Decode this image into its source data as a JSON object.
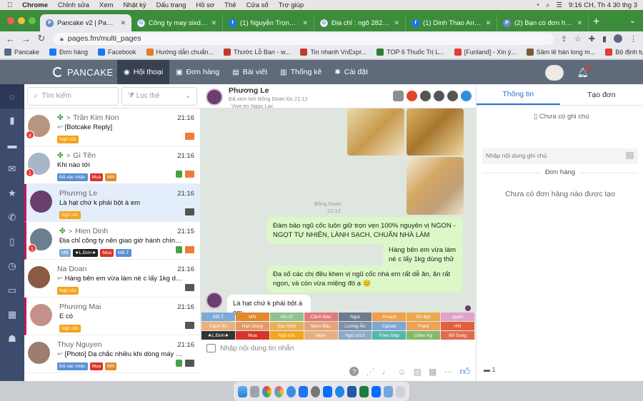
{
  "macbar": {
    "apple": "",
    "app": "Chrome",
    "menus": [
      "Chỉnh sửa",
      "Xem",
      "Nhật ký",
      "Dấu trang",
      "Hồ sơ",
      "Thẻ",
      "Cửa sổ",
      "Trợ giúp"
    ],
    "datetime": "9:16 CH, Th 4 30 thg 3"
  },
  "tabs": [
    {
      "title": "Pancake v2 | Pages.fm |",
      "icon": "P",
      "active": true
    },
    {
      "title": "Công ty may sixdo hoàn",
      "icon": "G"
    },
    {
      "title": "(1) Nguyễn Trọng Vinh |",
      "icon": "f"
    },
    {
      "title": "Địa chỉ : ngõ 282 Nguyễ",
      "icon": "G"
    },
    {
      "title": "(1) Dinh Thao Anh | Face",
      "icon": "f"
    },
    {
      "title": "(2) Bạn có đơn hàng mới",
      "icon": "P"
    }
  ],
  "address": {
    "url": "pages.fm/multi_pages"
  },
  "bookmarks": [
    "Pancake",
    "Đơn hàng",
    "Facebook",
    "Hướng dẫn chuẩn...",
    "Thước Lỗ Ban - w...",
    "Tin nhanh VnExpr...",
    "TOP 6 Thuốc Trị L...",
    "[Funland] - Xin ý...",
    "Sâm lê hàn long m...",
    "Bộ định tuyến WiF..."
  ],
  "app": {
    "logo": "PANCAKE",
    "nav": [
      {
        "label": "Hội thoại",
        "active": true
      },
      {
        "label": "Đơn hàng"
      },
      {
        "label": "Bài viết"
      },
      {
        "label": "Thống kê"
      },
      {
        "label": "Cài đặt"
      }
    ]
  },
  "filters": {
    "search_placeholder": "Tìm kiếm",
    "filter_label": "Lọc thẻ"
  },
  "conversations": [
    {
      "name": "Trần Kim Non",
      "leaf": true,
      "time": "21:16",
      "msg": "[Botcake Reply]",
      "reply": true,
      "badge": "4",
      "tags": [
        {
          "t": "Ngũ cốc",
          "c": "#f5a31a"
        }
      ],
      "icons": [
        "mail-orange"
      ],
      "avatar": "#b89580"
    },
    {
      "name": "Gì Tên",
      "leaf": true,
      "time": "21:16",
      "msg": "Khi nào tới",
      "reply": false,
      "badge": "1",
      "tags": [
        {
          "t": "Đã xác nhận",
          "c": "#5b8fd6"
        },
        {
          "t": "Mua",
          "c": "#d8342b"
        },
        {
          "t": "MN",
          "c": "#e08a2b"
        }
      ],
      "icons": [
        "phone",
        "mail-orange"
      ],
      "avatar": "#a7b7c8"
    },
    {
      "name": "Phương Le",
      "leaf": false,
      "time": "21:16",
      "msg": "Là hạt chứ k phải bột à em",
      "reply": false,
      "badge": "",
      "tags": [
        {
          "t": "Ngũ cốc",
          "c": "#f5a31a"
        }
      ],
      "icons": [
        "mail-dark"
      ],
      "avatar": "#6b3e6e",
      "selected": true
    },
    {
      "name": "Hien Dinh",
      "leaf": true,
      "time": "21:15",
      "msg": "Địa chỉ công ty nên giao giờ hành chính giúp c",
      "reply": false,
      "badge": "1",
      "tags": [
        {
          "t": "MB",
          "c": "#7ea8d8"
        },
        {
          "t": "★L.Đơn★",
          "c": "#222"
        },
        {
          "t": "Mua",
          "c": "#d8342b"
        },
        {
          "t": "MB.T",
          "c": "#5b8fd6"
        }
      ],
      "icons": [
        "phone",
        "mail-orange"
      ],
      "avatar": "#6b7f8e",
      "pink": true
    },
    {
      "name": "Na Doan",
      "leaf": false,
      "time": "21:16",
      "msg": "Hàng bên em vừa làm nè c lấy 1kg dùng thử nha ^^",
      "reply": true,
      "badge": "",
      "tags": [
        {
          "t": "Ngũ cốc",
          "c": "#f5a31a"
        }
      ],
      "icons": [
        "mail-dark"
      ],
      "avatar": "#8a5a44"
    },
    {
      "name": "Phương Mai",
      "leaf": false,
      "time": "21:16",
      "msg": "E có",
      "reply": false,
      "badge": "",
      "tags": [
        {
          "t": "Ngũ cốc",
          "c": "#f5a31a"
        }
      ],
      "icons": [
        "mail-dark"
      ],
      "avatar": "#c4918a",
      "pink": true
    },
    {
      "name": "Thuy Nguyen",
      "leaf": false,
      "time": "21:16",
      "msg": "[Photo] Dạ chắc nhiều khi dòng máy chị dùng ko t...",
      "reply": true,
      "badge": "",
      "tags": [
        {
          "t": "Đã xác nhận",
          "c": "#5b8fd6"
        },
        {
          "t": "Mua",
          "c": "#d8342b"
        },
        {
          "t": "MN",
          "c": "#e08a2b"
        }
      ],
      "icons": [
        "phone",
        "mail-dark"
      ],
      "avatar": "#9c7d70"
    }
  ],
  "chat": {
    "name": "Phương Le",
    "seen": "Đã xem bởi Bông Doan lúc 21:12",
    "sub": "Vive en Ngọc Lạc",
    "photo_sender": "Bông Doan",
    "photo_time": "21:13",
    "messages": [
      {
        "text": "Đảm bảo ngũ cốc luôn giữ trọn vẹn 100% nguyên vị NGON - NGỌT TỰ NHIÊN, LÀNH SẠCH, CHUẨN NHÀ LÀM"
      },
      {
        "text": "Hàng bên em vừa làm nè c lấy 1kg dùng thử nha ^^"
      },
      {
        "text": "Đa số các chị đều khen vị ngũ cốc nhà em rất dễ ăn, ăn rất ngon, và còn vừa miệng đó ạ 😊"
      }
    ],
    "incoming": "Là hạt chứ k phải bột à em",
    "input_placeholder": "Nhập nội dung tin nhắn"
  },
  "quick_tags": [
    {
      "t": "MB.T",
      "c": "#7ea8d8"
    },
    {
      "t": "MN",
      "c": "#e08a2b"
    },
    {
      "t": "Hỏi Sĩ",
      "c": "#8fc28f"
    },
    {
      "t": "Cảnh Báo",
      "c": "#e07b7b"
    },
    {
      "t": "Ngọt",
      "c": "#6d7c8c"
    },
    {
      "t": "Ymach",
      "c": "#f0a04b"
    },
    {
      "t": "Bỏ Bột",
      "c": "#e9a94f"
    },
    {
      "t": "spam",
      "c": "#e0a2c8"
    },
    {
      "t": "Cách Ăn",
      "c": "#e8b27c"
    },
    {
      "t": "Hạn Dùng",
      "c": "#e19a6a"
    },
    {
      "t": "Sau Sinh",
      "c": "#e5b05f"
    },
    {
      "t": "Mom Bầu",
      "c": "#e6a278"
    },
    {
      "t": "Lương Ăn",
      "c": "#7d91a8"
    },
    {
      "t": "Calsee",
      "c": "#7fa6d6"
    },
    {
      "t": "Feed",
      "c": "#e9a35a"
    },
    {
      "t": "HN",
      "c": "#e45f3c"
    },
    {
      "t": "★L.Đơn★",
      "c": "#333"
    },
    {
      "t": "Mua",
      "c": "#d8342b"
    },
    {
      "t": "Ngũ cốc",
      "c": "#f5a31a"
    },
    {
      "t": "Note",
      "c": "#e8b080"
    },
    {
      "t": "Ngũ cốc2",
      "c": "#8ea8c6"
    },
    {
      "t": "Free Ship",
      "c": "#57b7a7"
    },
    {
      "t": "Giảm Kg",
      "c": "#86b86a"
    },
    {
      "t": "Bổ Sung",
      "c": "#e06c4d"
    }
  ],
  "right": {
    "tab_info": "Thông tin",
    "tab_order": "Tạo đơn",
    "no_note": "Chưa có ghi chú",
    "note_placeholder": "Nhập nội dung ghi chú",
    "orders_title": "Đơn hàng",
    "no_orders": "Chưa có đơn hàng nào được tạo",
    "comments": "1"
  }
}
